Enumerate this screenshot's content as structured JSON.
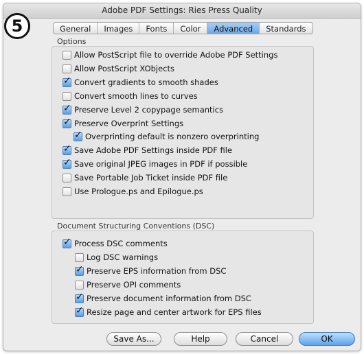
{
  "window": {
    "title": "Adobe PDF Settings: Ries Press Quality"
  },
  "step_badge": "5",
  "tabs": [
    {
      "label": "General"
    },
    {
      "label": "Images"
    },
    {
      "label": "Fonts"
    },
    {
      "label": "Color"
    },
    {
      "label": "Advanced",
      "active": true
    },
    {
      "label": "Standards"
    }
  ],
  "options_group": {
    "label": "Options",
    "items": [
      {
        "label": "Allow PostScript file to override Adobe PDF Settings",
        "checked": false
      },
      {
        "label": "Allow PostScript XObjects",
        "checked": false
      },
      {
        "label": "Convert gradients to smooth shades",
        "checked": true
      },
      {
        "label": "Convert smooth lines to curves",
        "checked": false
      },
      {
        "label": "Preserve Level 2 copypage semantics",
        "checked": true
      },
      {
        "label": "Preserve Overprint Settings",
        "checked": true
      },
      {
        "label": "Overprinting default is nonzero overprinting",
        "checked": true
      },
      {
        "label": "Save Adobe PDF Settings inside PDF file",
        "checked": true
      },
      {
        "label": "Save original JPEG images in PDF if possible",
        "checked": true
      },
      {
        "label": "Save Portable Job Ticket inside PDF file",
        "checked": false
      },
      {
        "label": "Use Prologue.ps and Epilogue.ps",
        "checked": false
      }
    ]
  },
  "dsc_group": {
    "label": "Document Structuring Conventions (DSC)",
    "items": [
      {
        "label": "Process DSC comments",
        "checked": true
      },
      {
        "label": "Log DSC warnings",
        "checked": false
      },
      {
        "label": "Preserve EPS information from DSC",
        "checked": true
      },
      {
        "label": "Preserve OPI comments",
        "checked": false
      },
      {
        "label": "Preserve document information from DSC",
        "checked": true
      },
      {
        "label": "Resize page and center artwork for EPS files",
        "checked": true
      }
    ]
  },
  "buttons": {
    "save_as": "Save As...",
    "help": "Help",
    "cancel": "Cancel",
    "ok": "OK"
  }
}
